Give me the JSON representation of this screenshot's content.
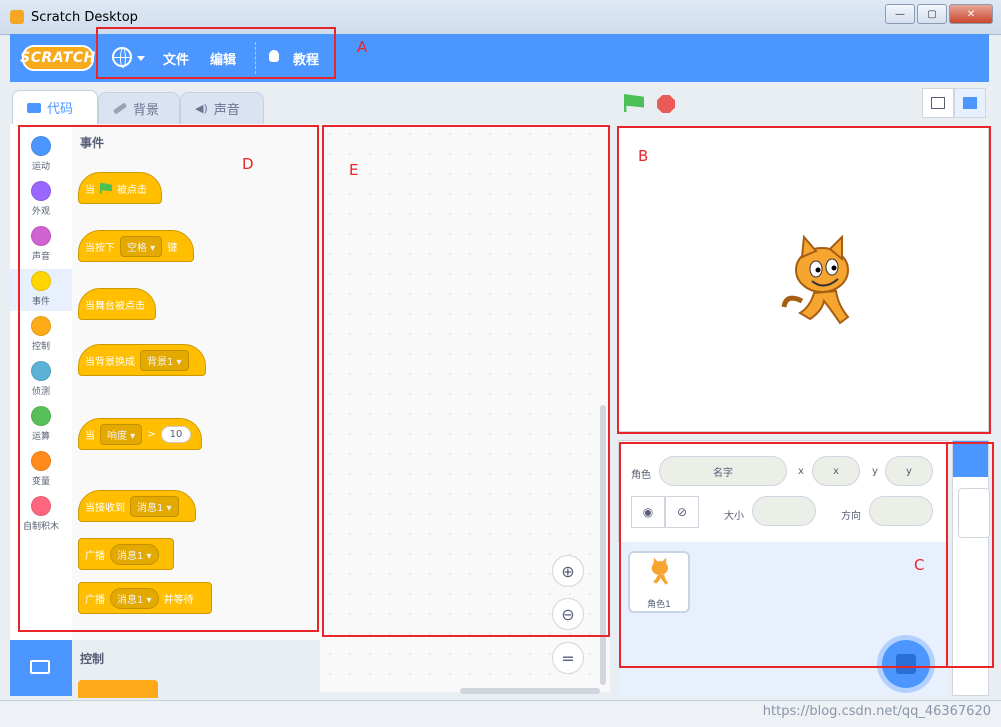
{
  "window": {
    "title": "Scratch Desktop",
    "buttons": [
      "—",
      "▢",
      "✕"
    ]
  },
  "menubar": {
    "logo": "SCRATCH",
    "file": "文件",
    "edit": "编辑",
    "tutorials": "教程"
  },
  "tabs": [
    {
      "label": "代码"
    },
    {
      "label": "背景"
    },
    {
      "label": "声音"
    }
  ],
  "categories": [
    {
      "label": "运动",
      "color": "#4c97ff"
    },
    {
      "label": "外观",
      "color": "#9966ff"
    },
    {
      "label": "声音",
      "color": "#cf63cf"
    },
    {
      "label": "事件",
      "color": "#ffd500"
    },
    {
      "label": "控制",
      "color": "#ffab19"
    },
    {
      "label": "侦测",
      "color": "#5cb1d6"
    },
    {
      "label": "运算",
      "color": "#59c059"
    },
    {
      "label": "变量",
      "color": "#ff8c1a"
    },
    {
      "label": "自制积木",
      "color": "#ff6680"
    }
  ],
  "palette": {
    "events_heading": "事件",
    "control_heading": "控制",
    "blocks": {
      "when_flag": {
        "pre": "当",
        "post": "被点击"
      },
      "when_key": {
        "pre": "当按下",
        "menu": "空格",
        "post": "键"
      },
      "when_stage": {
        "text": "当舞台被点击"
      },
      "when_backdrop": {
        "pre": "当背景换成",
        "menu": "背景1"
      },
      "when_loudness": {
        "pre": "当",
        "menu": "响度",
        "op": ">",
        "value": "10"
      },
      "when_receive": {
        "pre": "当接收到",
        "menu": "消息1"
      },
      "broadcast": {
        "pre": "广播",
        "menu": "消息1"
      },
      "broadcast_wait": {
        "pre": "广播",
        "menu": "消息1",
        "post": "并等待"
      }
    }
  },
  "sprite_info": {
    "sprite_label": "角色",
    "name_placeholder": "名字",
    "x_label": "x",
    "x_placeholder": "x",
    "y_label": "y",
    "y_placeholder": "y",
    "size_label": "大小",
    "direction_label": "方向"
  },
  "sprites": [
    {
      "name": "角色1"
    }
  ],
  "annotations": {
    "a": "A",
    "b": "B",
    "c": "C",
    "d": "D",
    "e": "E"
  },
  "watermark": "https://blog.csdn.net/qq_46367620",
  "colors": {
    "accent": "#4c97ff",
    "events": "#ffbf00",
    "annotation": "#e8262a"
  }
}
